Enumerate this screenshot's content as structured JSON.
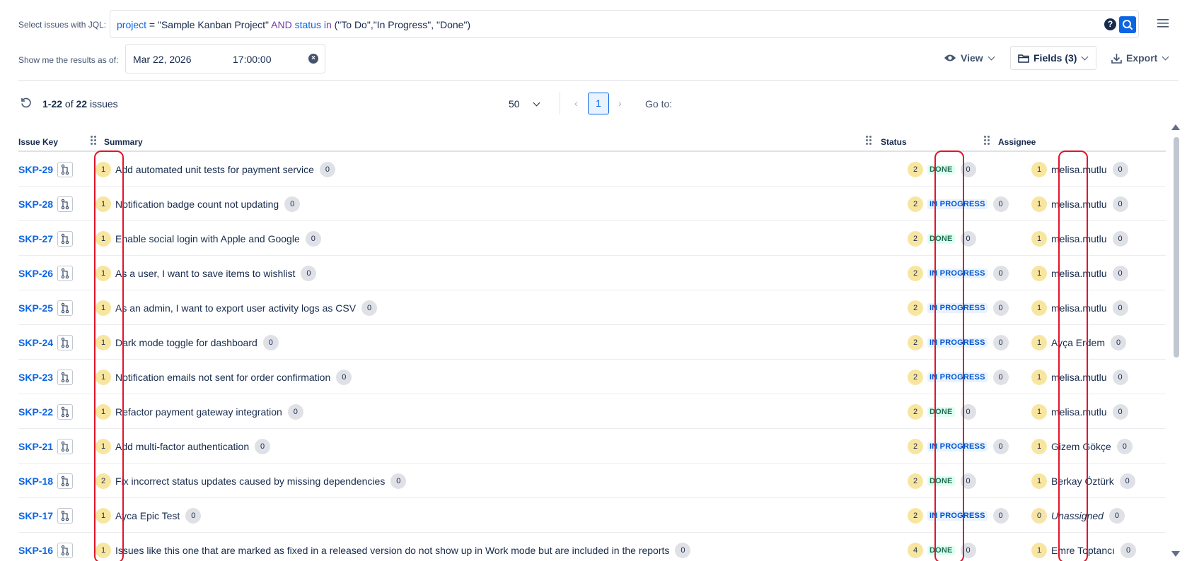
{
  "jql": {
    "label": "Select issues with JQL:",
    "parts": [
      {
        "text": "project",
        "kind": "field"
      },
      {
        "text": " = \"Sample Kanban Project\" ",
        "kind": "plain"
      },
      {
        "text": "AND",
        "kind": "op"
      },
      {
        "text": " ",
        "kind": "plain"
      },
      {
        "text": "status",
        "kind": "field"
      },
      {
        "text": " ",
        "kind": "plain"
      },
      {
        "text": "in",
        "kind": "op"
      },
      {
        "text": " (\"To Do\",\"In Progress\", \"Done\")",
        "kind": "plain"
      }
    ],
    "help": "?"
  },
  "asof": {
    "label": "Show me the results as of:",
    "date": "Mar 22, 2026",
    "time": "17:00:00"
  },
  "toolbar": {
    "view_label": "View",
    "fields_label": "Fields (3)",
    "export_label": "Export"
  },
  "pager": {
    "range": "1-22",
    "of_word": "of",
    "total": "22",
    "issues_word": "issues",
    "per_page": "50",
    "current_page": "1",
    "goto_label": "Go to:"
  },
  "columns": {
    "key": "Issue Key",
    "summary": "Summary",
    "status": "Status",
    "assignee": "Assignee"
  },
  "colors": {
    "accent": "#0c66e4",
    "highlight": "#e2142b",
    "done": "#216e4e",
    "in_progress": "#0055cc"
  },
  "rows": [
    {
      "key": "SKP-29",
      "sum_n": "1",
      "summary": "Add automated unit tests for payment service",
      "sum_c": "0",
      "stat_n": "2",
      "status": "DONE",
      "status_type": "done",
      "stat_c": "0",
      "asg_n": "1",
      "assignee": "melisa.mutlu",
      "asg_c": "0"
    },
    {
      "key": "SKP-28",
      "sum_n": "1",
      "summary": "Notification badge count not updating",
      "sum_c": "0",
      "stat_n": "2",
      "status": "IN PROGRESS",
      "status_type": "prog",
      "stat_c": "0",
      "asg_n": "1",
      "assignee": "melisa.mutlu",
      "asg_c": "0"
    },
    {
      "key": "SKP-27",
      "sum_n": "1",
      "summary": "Enable social login with Apple and Google",
      "sum_c": "0",
      "stat_n": "2",
      "status": "DONE",
      "status_type": "done",
      "stat_c": "0",
      "asg_n": "1",
      "assignee": "melisa.mutlu",
      "asg_c": "0"
    },
    {
      "key": "SKP-26",
      "sum_n": "1",
      "summary": "As a user, I want to save items to wishlist",
      "sum_c": "0",
      "stat_n": "2",
      "status": "IN PROGRESS",
      "status_type": "prog",
      "stat_c": "0",
      "asg_n": "1",
      "assignee": "melisa.mutlu",
      "asg_c": "0"
    },
    {
      "key": "SKP-25",
      "sum_n": "1",
      "summary": "As an admin, I want to export user activity logs as CSV",
      "sum_c": "0",
      "stat_n": "2",
      "status": "IN PROGRESS",
      "status_type": "prog",
      "stat_c": "0",
      "asg_n": "1",
      "assignee": "melisa.mutlu",
      "asg_c": "0"
    },
    {
      "key": "SKP-24",
      "sum_n": "1",
      "summary": "Dark mode toggle for dashboard",
      "sum_c": "0",
      "stat_n": "2",
      "status": "IN PROGRESS",
      "status_type": "prog",
      "stat_c": "0",
      "asg_n": "1",
      "assignee": "Ayça Erdem",
      "asg_c": "0"
    },
    {
      "key": "SKP-23",
      "sum_n": "1",
      "summary": "Notification emails not sent for order confirmation",
      "sum_c": "0",
      "stat_n": "2",
      "status": "IN PROGRESS",
      "status_type": "prog",
      "stat_c": "0",
      "asg_n": "1",
      "assignee": "melisa.mutlu",
      "asg_c": "0"
    },
    {
      "key": "SKP-22",
      "sum_n": "1",
      "summary": "Refactor payment gateway integration",
      "sum_c": "0",
      "stat_n": "2",
      "status": "DONE",
      "status_type": "done",
      "stat_c": "0",
      "asg_n": "1",
      "assignee": "melisa.mutlu",
      "asg_c": "0"
    },
    {
      "key": "SKP-21",
      "sum_n": "1",
      "summary": "Add multi-factor authentication",
      "sum_c": "0",
      "stat_n": "2",
      "status": "IN PROGRESS",
      "status_type": "prog",
      "stat_c": "0",
      "asg_n": "1",
      "assignee": "Gizem Gökçe",
      "asg_c": "0"
    },
    {
      "key": "SKP-18",
      "sum_n": "2",
      "summary": "Fix incorrect status updates caused by missing dependencies",
      "sum_c": "0",
      "stat_n": "2",
      "status": "DONE",
      "status_type": "done",
      "stat_c": "0",
      "asg_n": "1",
      "assignee": "Berkay Öztürk",
      "asg_c": "0"
    },
    {
      "key": "SKP-17",
      "sum_n": "1",
      "summary": "Ayca Epic Test",
      "sum_c": "0",
      "stat_n": "2",
      "status": "IN PROGRESS",
      "status_type": "prog",
      "stat_c": "0",
      "asg_n": "0",
      "assignee": "Unassigned",
      "asg_c": "0",
      "unassigned": true
    },
    {
      "key": "SKP-16",
      "sum_n": "1",
      "summary": "Issues like this one that are marked as fixed in a released version do not show up in Work mode but are included in the reports",
      "sum_c": "0",
      "stat_n": "4",
      "status": "DONE",
      "status_type": "done",
      "stat_c": "0",
      "asg_n": "1",
      "assignee": "Emre Toptancı",
      "asg_c": "0"
    }
  ]
}
